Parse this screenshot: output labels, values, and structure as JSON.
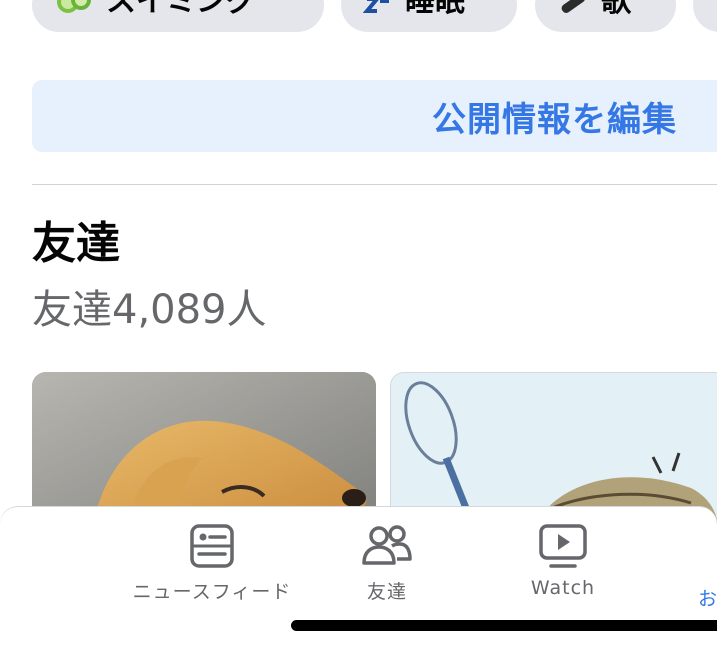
{
  "hobbies": [
    {
      "label": "スイミング",
      "icon": "cucumber-icon"
    },
    {
      "label": "睡眠",
      "icon": "sleep-zz-icon"
    },
    {
      "label": "歌",
      "icon": "microphone-icon"
    },
    {
      "label": "",
      "icon": ""
    }
  ],
  "edit_button": {
    "label": "公開情報を編集"
  },
  "friends_section": {
    "title": "友達",
    "count_text": "友達4,089人"
  },
  "tabbar": {
    "items": [
      {
        "label": "ニュースフィード",
        "icon": "newsfeed-icon"
      },
      {
        "label": "友達",
        "icon": "friends-icon"
      },
      {
        "label": "Watch",
        "icon": "watch-icon"
      },
      {
        "label": "お",
        "icon": ""
      }
    ]
  },
  "colors": {
    "accent": "#3578e5",
    "chip_bg": "#e4e6eb",
    "edit_bg": "#e7f0fd",
    "secondary_text": "#65676b"
  }
}
